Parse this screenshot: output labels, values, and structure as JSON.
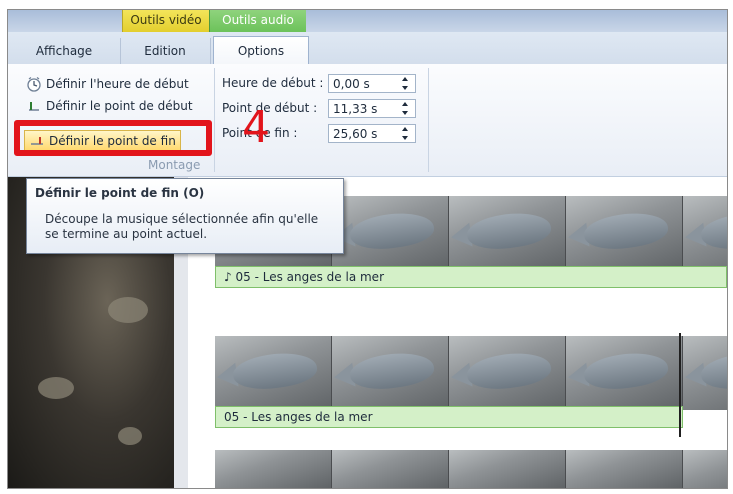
{
  "contextual_tabs": {
    "video": "Outils vidéo",
    "audio": "Outils audio"
  },
  "tabs": [
    {
      "label": "Affichage"
    },
    {
      "label": "Edition"
    },
    {
      "label": "Options",
      "active": true
    }
  ],
  "ribbon": {
    "buttons": {
      "start_time": "Définir l'heure de début",
      "start_point": "Définir le point de début",
      "end_point": "Définir le point de fin"
    },
    "group_label": "Montage",
    "fields": [
      {
        "label": "Heure de début :",
        "value": "0,00 s"
      },
      {
        "label": "Point de début :",
        "value": "11,33 s"
      },
      {
        "label": "Point de fin :",
        "value": "25,60 s"
      }
    ]
  },
  "annotation": {
    "step_number": "4",
    "highlight_color": "#e2141b"
  },
  "tooltip": {
    "title": "Définir le point de fin (O)",
    "body": "Découpe la musique sélectionnée afin qu'elle se termine au point actuel."
  },
  "timeline": {
    "tracks": [
      {
        "audio_label": "05 - Les anges de la mer",
        "has_note_icon": true
      },
      {
        "audio_label": "05 - Les anges de la mer",
        "has_note_icon": false
      }
    ]
  },
  "colors": {
    "video_tools": "#e3cf2e",
    "audio_tools": "#6cc25a",
    "audio_clip": "#d4f0c8"
  }
}
